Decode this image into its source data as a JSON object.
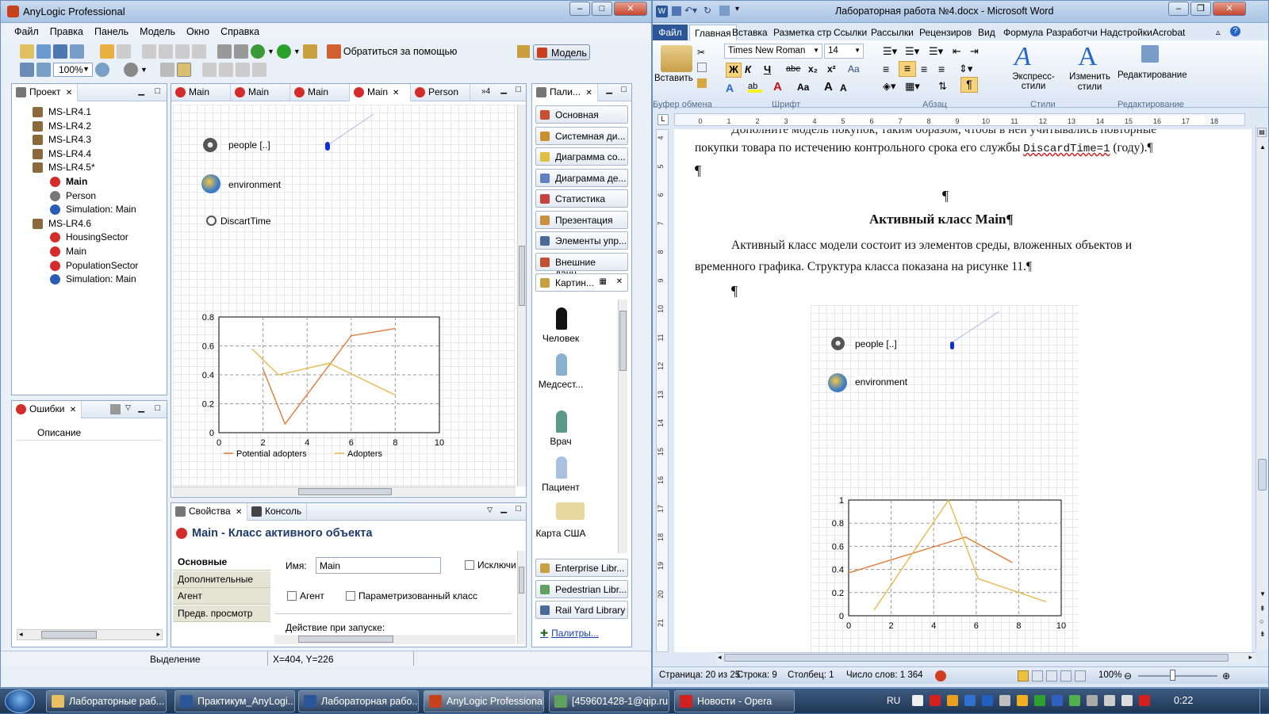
{
  "anylogic": {
    "title": "AnyLogic Professional",
    "menu": [
      "Файл",
      "Правка",
      "Панель",
      "Модель",
      "Окно",
      "Справка"
    ],
    "toolbar": {
      "zoom": "100%",
      "help_label": "Обратиться за помощью",
      "model_label": "Модель"
    },
    "project": {
      "tab": "Проект",
      "items": [
        {
          "label": "MS-LR4.1",
          "level": 0,
          "icon": "package-icon"
        },
        {
          "label": "MS-LR4.2",
          "level": 0,
          "icon": "package-icon"
        },
        {
          "label": "MS-LR4.3",
          "level": 0,
          "icon": "package-icon"
        },
        {
          "label": "MS-LR4.4",
          "level": 0,
          "icon": "package-icon"
        },
        {
          "label": "MS-LR4.5*",
          "level": 0,
          "icon": "package-icon"
        },
        {
          "label": "Main",
          "level": 1,
          "icon": "active-class-icon",
          "bold": true
        },
        {
          "label": "Person",
          "level": 1,
          "icon": "agent-icon"
        },
        {
          "label": "Simulation: Main",
          "level": 1,
          "icon": "experiment-icon"
        },
        {
          "label": "MS-LR4.6",
          "level": 0,
          "icon": "package-icon"
        },
        {
          "label": "HousingSector",
          "level": 1,
          "icon": "active-class-icon"
        },
        {
          "label": "Main",
          "level": 1,
          "icon": "active-class-icon"
        },
        {
          "label": "PopulationSector",
          "level": 1,
          "icon": "active-class-icon"
        },
        {
          "label": "Simulation: Main",
          "level": 1,
          "icon": "experiment-icon"
        }
      ]
    },
    "errors": {
      "tab": "Ошибки",
      "column": "Описание"
    },
    "editor_tabs": [
      "Main",
      "Main",
      "Main",
      "Main",
      "Person"
    ],
    "editor_overflow": "4",
    "canvas": {
      "people_label": "people [..]",
      "environment_label": "environment",
      "discard_label": "DiscartTime"
    },
    "palette": {
      "tab": "Пали...",
      "items": [
        "Основная",
        "Системная ди...",
        "Диаграмма со...",
        "Диаграмма де...",
        "Статистика",
        "Презентация",
        "Элементы упр...",
        "Внешние данн...",
        "Картин..."
      ],
      "pictures": [
        "Человек",
        "Медсест...",
        "Врач",
        "Пациент",
        "Карта США"
      ],
      "libraries": [
        "Enterprise Libr...",
        "Pedestrian Libr...",
        "Rail Yard Library"
      ],
      "palettes_link": "Палитры..."
    },
    "properties": {
      "tab": "Свойства",
      "console_tab": "Консоль",
      "title": "Main - Класс активного объекта",
      "side_tabs": [
        "Основные",
        "Дополнительные",
        "Агент",
        "Предв. просмотр"
      ],
      "name_label": "Имя:",
      "name_value": "Main",
      "exclude_label": "Исключи",
      "agent_label": "Агент",
      "param_class_label": "Параметризованный класс",
      "startup_label": "Действие при запуске:"
    },
    "status": {
      "mode": "Выделение",
      "coords": "X=404, Y=226"
    }
  },
  "word": {
    "title": "Лабораторная работа №4.docx - Microsoft Word",
    "tabs": [
      "Файл",
      "Главная",
      "Вставка",
      "Разметка стр",
      "Ссылки",
      "Рассылки",
      "Рецензиров",
      "Вид",
      "Формула",
      "Разработчи",
      "Надстройки",
      "Acrobat"
    ],
    "font_name": "Times New Roman",
    "font_size": "14",
    "groups": [
      "Буфер обмена",
      "Шрифт",
      "Абзац",
      "Стили",
      "Редактирование"
    ],
    "buttons": {
      "paste": "Вставить",
      "express_styles": "Экспресс-стили",
      "change_styles": "Изменить стили",
      "editing": "Редактирование"
    },
    "doc": {
      "line1": "Дополните модель покупок, таким образом, чтобы в ней учитывались повторные",
      "line2_a": "покупки товара по истечению контрольного срока его службы ",
      "line2_code": "DiscardTime=1",
      "line2_b": " (году).¶",
      "pilcrow": "¶",
      "heading": "Активный класс Main¶",
      "para1": "Активный класс модели состоит из элементов среды, вложенных объектов и",
      "para2": "временного графика. Структура класса показана на рисунке 11.¶",
      "people_label": "people [..]",
      "environment_label": "environment"
    },
    "status": {
      "page": "Страница: 20 из 25",
      "line": "Строка: 9",
      "column": "Столбец: 1",
      "words": "Число слов: 1 364",
      "zoom": "100%"
    }
  },
  "taskbar": {
    "items": [
      "Лабораторные раб...",
      "Практикум_AnyLogi...",
      "Лабораторная рабо...",
      "AnyLogic Professional",
      "[459601428-1@qip.ru...",
      "Новости - Opera"
    ],
    "lang": "RU",
    "time": "0:22"
  },
  "chart_data": [
    {
      "type": "line",
      "x_ticks": [
        "0",
        "2",
        "4",
        "6",
        "8",
        "10"
      ],
      "y_ticks": [
        "0",
        "0.2",
        "0.4",
        "0.6",
        "0.8"
      ],
      "xlim": [
        0,
        10
      ],
      "ylim": [
        0,
        0.8
      ],
      "legend": [
        "Potential adopters",
        "Adopters"
      ],
      "series": [
        {
          "name": "Potential adopters",
          "color": "#e07b3a",
          "x": [
            2,
            3,
            6,
            8
          ],
          "y": [
            0.44,
            0.06,
            0.67,
            0.72
          ]
        },
        {
          "name": "Adopters",
          "color": "#e8b94a",
          "x": [
            1.5,
            2.7,
            5,
            8
          ],
          "y": [
            0.58,
            0.4,
            0.48,
            0.26
          ]
        }
      ]
    },
    {
      "type": "line",
      "x_ticks": [
        "0",
        "2",
        "4",
        "6",
        "8",
        "10"
      ],
      "y_ticks": [
        "0",
        "0.2",
        "0.4",
        "0.6",
        "0.8",
        "1"
      ],
      "xlim": [
        0,
        10
      ],
      "ylim": [
        0,
        1
      ],
      "series": [
        {
          "color": "#e07b3a",
          "x": [
            0,
            5.5,
            7.7
          ],
          "y": [
            0.37,
            0.68,
            0.46
          ]
        },
        {
          "color": "#e8b94a",
          "x": [
            1.2,
            4.7,
            6.1,
            9.3
          ],
          "y": [
            0.05,
            1.0,
            0.32,
            0.12
          ]
        }
      ]
    }
  ]
}
